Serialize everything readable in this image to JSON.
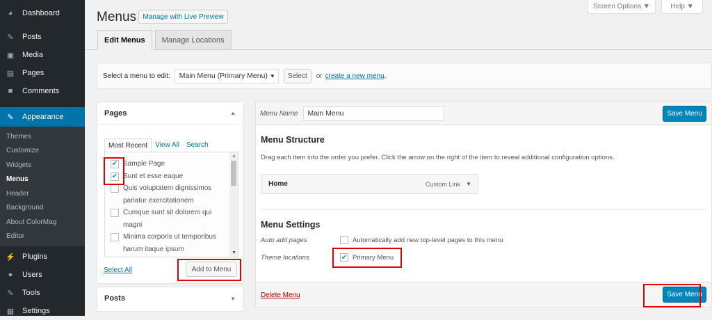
{
  "admin_menu": {
    "top_items": [
      {
        "label": "Dashboard",
        "icon": "dashboard-icon",
        "glyph": "◕"
      },
      {
        "label": "Posts",
        "icon": "pin-icon",
        "glyph": "✎"
      },
      {
        "label": "Media",
        "icon": "media-icon",
        "glyph": "▣"
      },
      {
        "label": "Pages",
        "icon": "pages-icon",
        "glyph": "▤"
      },
      {
        "label": "Comments",
        "icon": "comment-icon",
        "glyph": "■"
      }
    ],
    "current": {
      "label": "Appearance",
      "icon": "brush-icon",
      "glyph": "✎"
    },
    "submenu": [
      "Themes",
      "Customize",
      "Widgets",
      "Menus",
      "Header",
      "Background",
      "About ColorMag",
      "Editor"
    ],
    "bottom_items": [
      {
        "label": "Plugins",
        "icon": "plugin-icon",
        "glyph": "⚡"
      },
      {
        "label": "Users",
        "icon": "users-icon",
        "glyph": "●"
      },
      {
        "label": "Tools",
        "icon": "wrench-icon",
        "glyph": "✎"
      },
      {
        "label": "Settings",
        "icon": "settings-icon",
        "glyph": "▦"
      }
    ]
  },
  "header": {
    "title": "Menus",
    "live_preview": "Manage with Live Preview",
    "screen_options": "Screen Options ▼",
    "help": "Help ▼"
  },
  "tabs": [
    "Edit Menus",
    "Manage Locations"
  ],
  "select_bar": {
    "label": "Select a menu to edit:",
    "selected": "Main Menu (Primary Menu)",
    "select_btn": "Select",
    "or": "or",
    "create_link": "create a new menu",
    "period": "."
  },
  "pages_box": {
    "title": "Pages",
    "tabs": [
      "Most Recent",
      "View All",
      "Search"
    ],
    "items": [
      {
        "label": "Sample Page",
        "checked": true
      },
      {
        "label": "Sunt et esse eaque",
        "checked": true
      },
      {
        "label": "Quis voluptatem dignissimos pariatur exercitationem",
        "checked": false
      },
      {
        "label": "Cumque sunt sit dolorem qui magni",
        "checked": false
      },
      {
        "label": "Minima corporis ut temporibus harum itaque ipsum",
        "checked": false
      }
    ],
    "select_all": "Select All",
    "add_button": "Add to Menu"
  },
  "posts_box": {
    "title": "Posts"
  },
  "menu_editor": {
    "name_label": "Menu Name",
    "name_value": "Main Menu",
    "save_label": "Save Menu",
    "structure_title": "Menu Structure",
    "structure_desc": "Drag each item into the order you prefer. Click the arrow on the right of the item to reveal additional configuration options.",
    "item": {
      "title": "Home",
      "type": "Custom Link"
    },
    "settings_title": "Menu Settings",
    "auto_add_label": "Auto add pages",
    "auto_add_text": "Automatically add new top-level pages to this menu",
    "locations_label": "Theme locations",
    "primary_menu": "Primary Menu",
    "delete_label": "Delete Menu"
  },
  "colors": {
    "accent": "#0073aa",
    "primary_button": "#0085ba",
    "highlight": "#e50000",
    "sidebar": "#23282d"
  }
}
